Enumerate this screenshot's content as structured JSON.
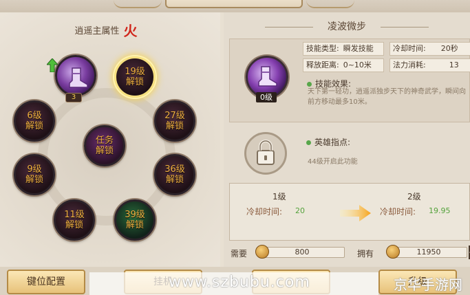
{
  "window": {
    "title_plaque": ""
  },
  "left": {
    "attribute_label": "逍遥主属性",
    "attribute_value": "火",
    "first_skill_level_badge": "3",
    "nodes": [
      {
        "level": "19级",
        "lock": "解锁"
      },
      {
        "level": "6级",
        "lock": "解锁"
      },
      {
        "level": "27级",
        "lock": "解锁"
      },
      {
        "level": "任务",
        "lock": "解锁"
      },
      {
        "level": "9级",
        "lock": "解锁"
      },
      {
        "level": "36级",
        "lock": "解锁"
      },
      {
        "level": "11级",
        "lock": "解锁"
      },
      {
        "level": "39级",
        "lock": "解锁"
      }
    ]
  },
  "right": {
    "skill_name": "凌波微步",
    "skill_icon_level": "0级",
    "stats": {
      "type_key": "技能类型:",
      "type_val": "瞬发技能",
      "cd_key": "冷却时间:",
      "cd_val": "20秒",
      "range_key": "释放距离:",
      "range_val": "0~10米",
      "mana_key": "法力消耗:",
      "mana_val": "13"
    },
    "effect_title": "技能效果:",
    "effect_text": "天下第一轻功，逍遥派独步天下的神奇武学，瞬间向前方移动最多10米。",
    "hint_title": "英雄指点:",
    "hint_text": "44级开启此功能",
    "compare": {
      "from_level": "1级",
      "to_level": "2级",
      "cd_label": "冷却时间:",
      "cd_from": "20",
      "cd_to": "19.95"
    },
    "cost": {
      "need_label": "需要",
      "need_val": "800",
      "have_label": "拥有",
      "have_val": "11950",
      "plus": "+"
    }
  },
  "bottom": {
    "keybind_button": "键位配置",
    "hang_button": "挂机",
    "upgrade_button": "升级",
    "watermark": "www.szbubu.com",
    "watermark2": "京华手游网"
  },
  "colors": {
    "accent_gold": "#f0b040",
    "fire_red": "#d0261b",
    "green": "#54a23c"
  }
}
